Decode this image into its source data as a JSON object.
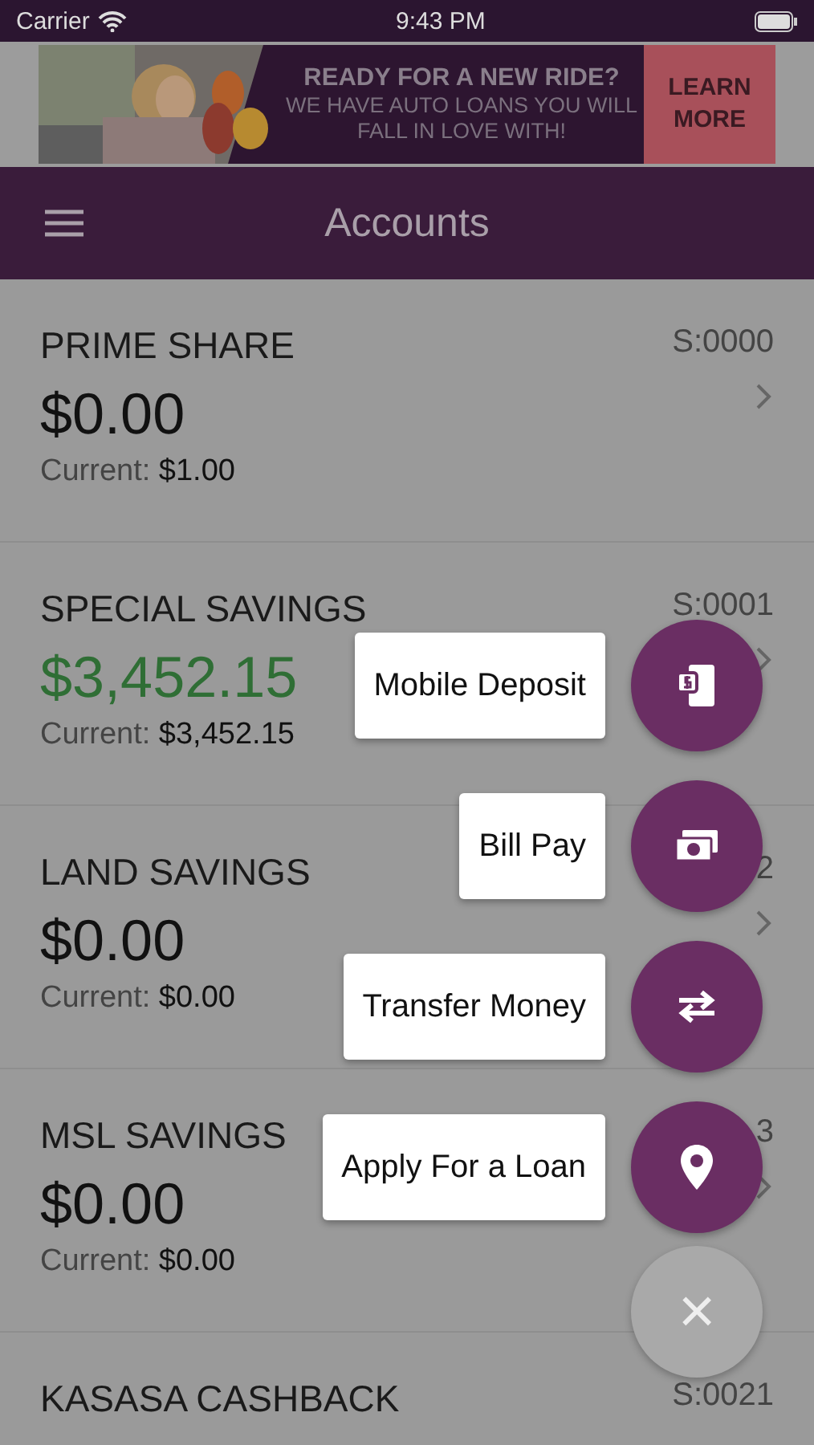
{
  "status_bar": {
    "carrier": "Carrier",
    "time": "9:43 PM"
  },
  "banner": {
    "kind": "picture",
    "headline": "READY FOR A NEW RIDE?",
    "text": "WE HAVE AUTO LOANS YOU WILL FALL IN LOVE WITH!",
    "button": "LEARN MORE"
  },
  "nav": {
    "title": "Accounts"
  },
  "accounts": [
    {
      "name": "PRIME SHARE",
      "id": "S:0000",
      "balance": "$0.00",
      "color": "#111111",
      "current_label": "Current:",
      "current": "$1.00"
    },
    {
      "name": "SPECIAL SAVINGS",
      "id": "S:0001",
      "balance": "$3,452.15",
      "color": "#2f6e35",
      "current_label": "Current:",
      "current": "$3,452.15"
    },
    {
      "name": "LAND SAVINGS",
      "id": "2",
      "balance": "$0.00",
      "color": "#111111",
      "current_label": "Current:",
      "current": "$0.00"
    },
    {
      "name": "MSL SAVINGS",
      "id": "3",
      "balance": "$0.00",
      "color": "#111111",
      "current_label": "Current:",
      "current": "$0.00"
    },
    {
      "name": "KASASA CASHBACK",
      "id": "S:0021"
    }
  ],
  "actions": [
    {
      "label": "Mobile Deposit",
      "kind": "deposit"
    },
    {
      "label": "Bill Pay",
      "kind": "bill"
    },
    {
      "label": "Transfer Money",
      "kind": "transfer"
    },
    {
      "label": "Apply For a Loan",
      "kind": "location"
    }
  ],
  "close_button": {
    "label": "×"
  }
}
